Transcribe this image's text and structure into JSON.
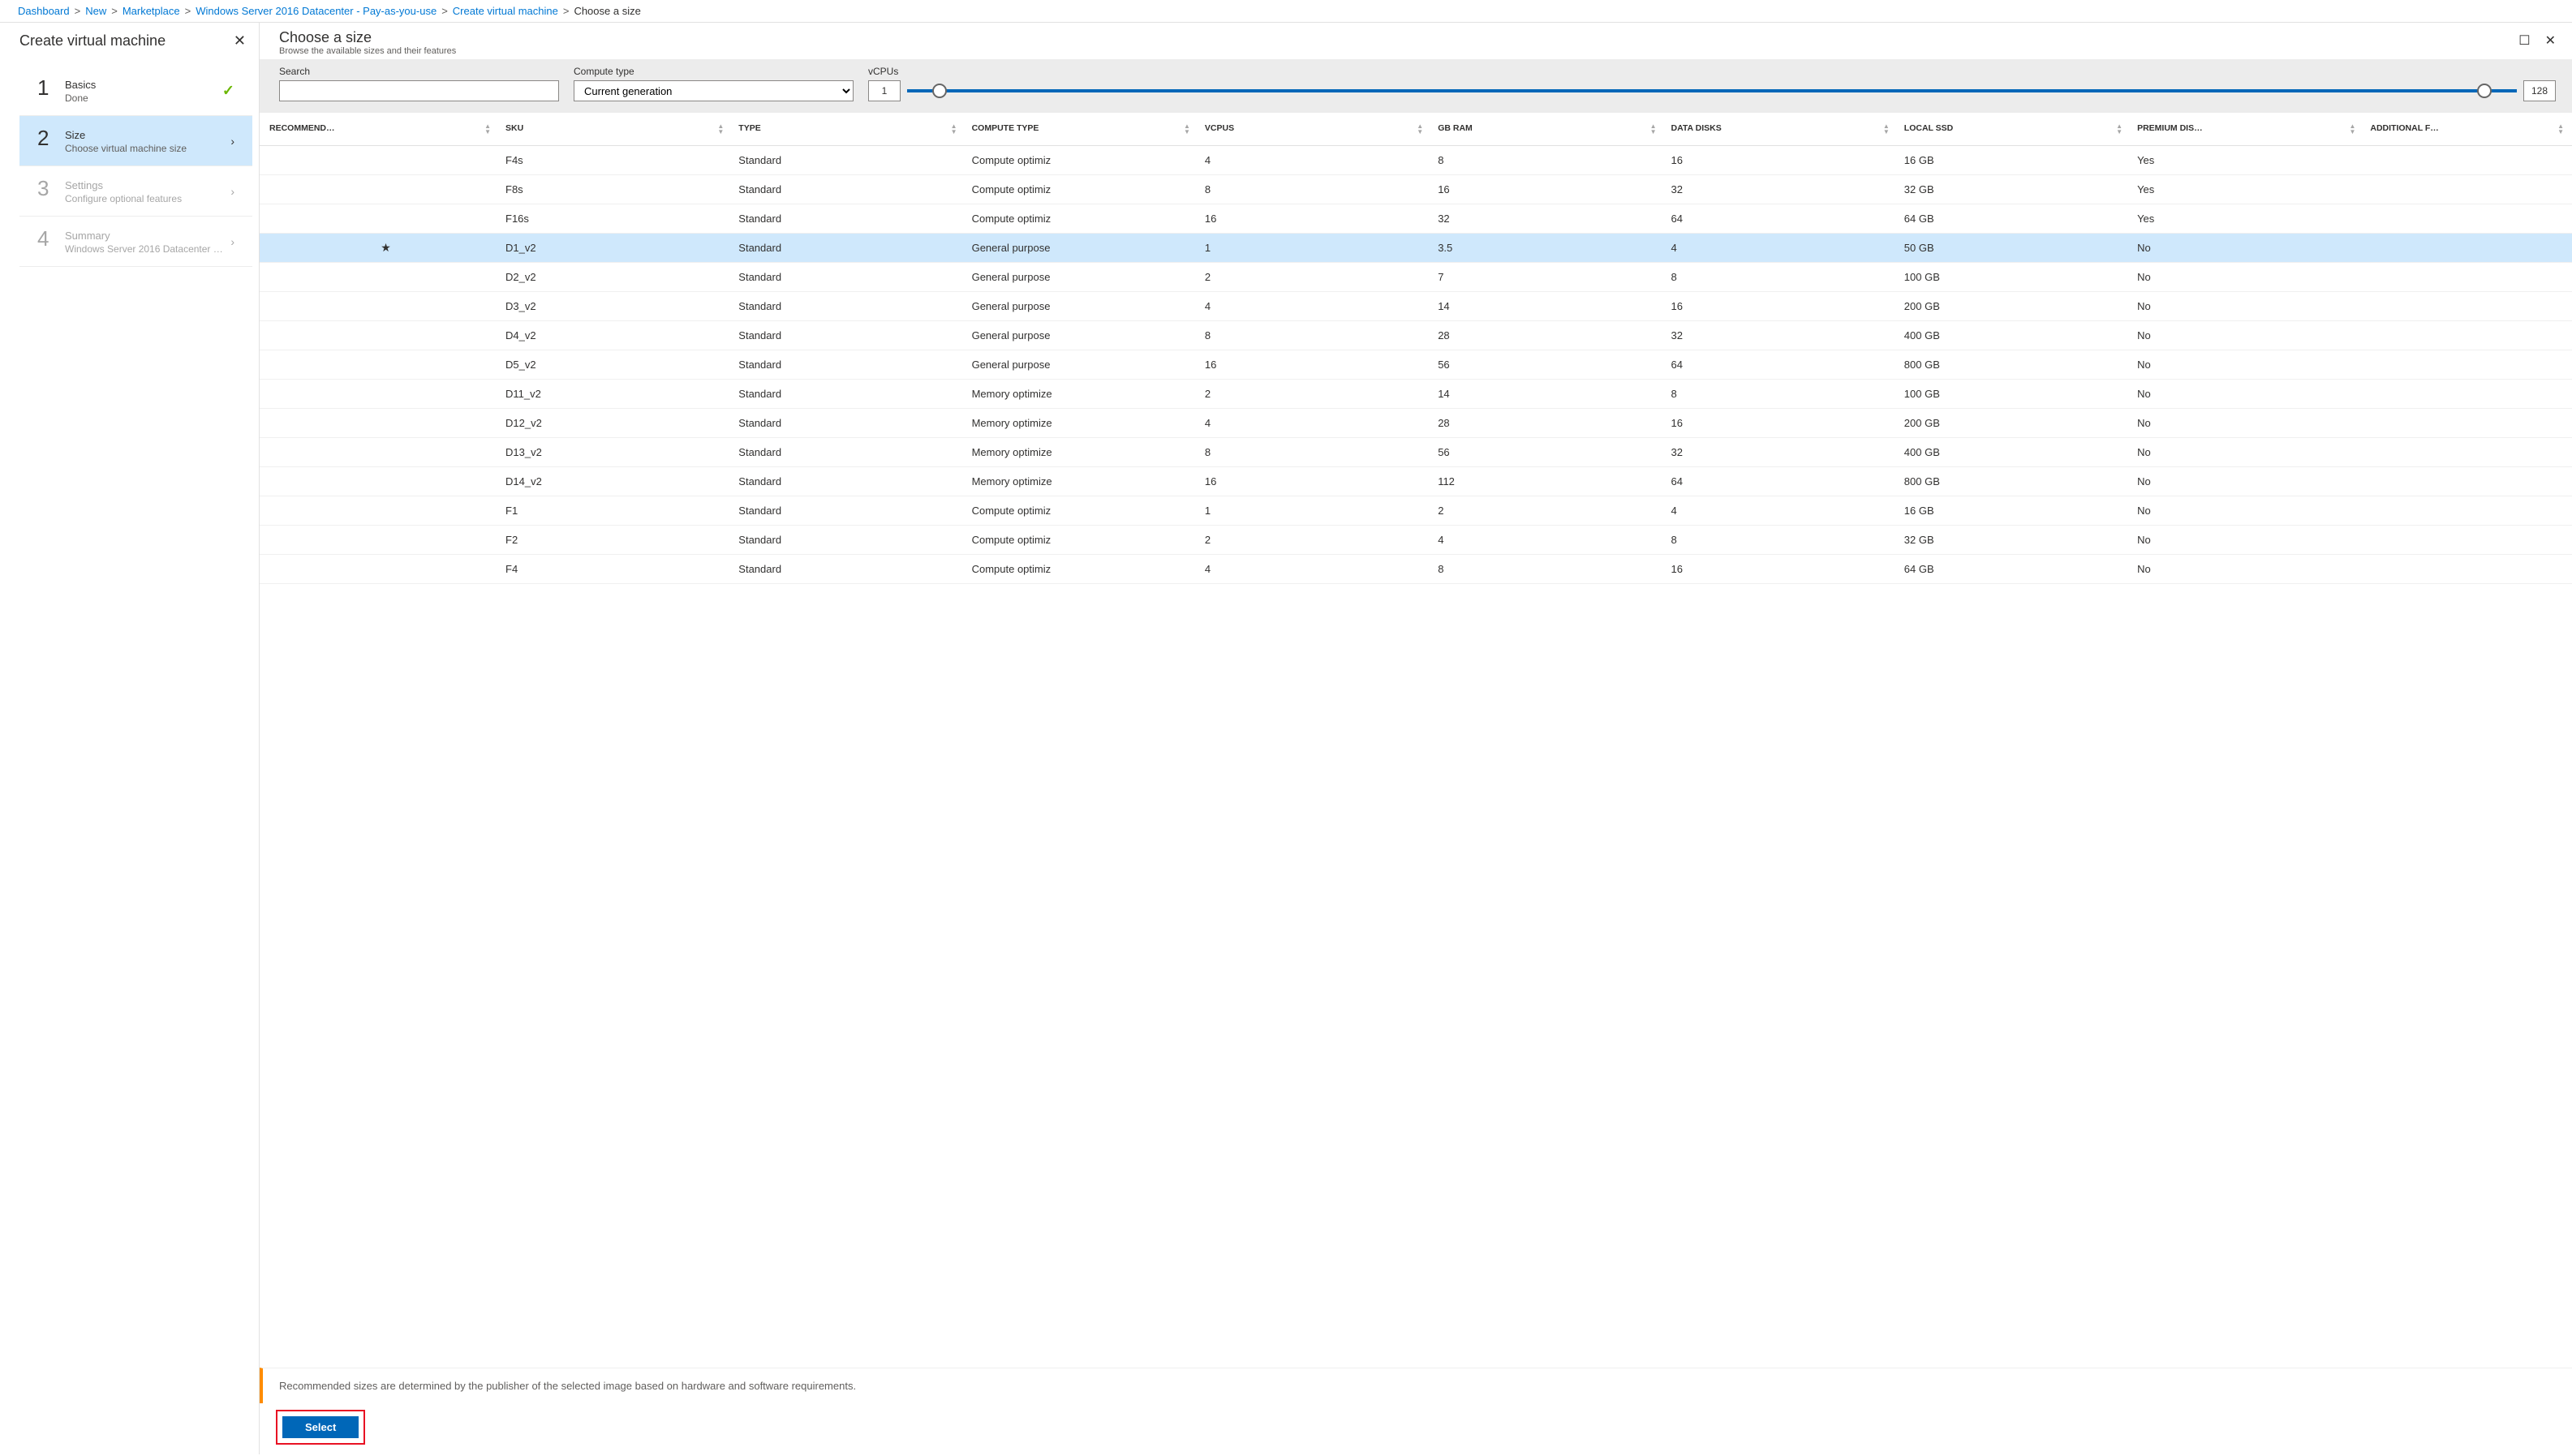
{
  "breadcrumb": {
    "items": [
      {
        "label": "Dashboard",
        "link": true
      },
      {
        "label": "New",
        "link": true
      },
      {
        "label": "Marketplace",
        "link": true
      },
      {
        "label": "Windows Server 2016 Datacenter - Pay-as-you-use",
        "link": true
      },
      {
        "label": "Create virtual machine",
        "link": true
      },
      {
        "label": "Choose a size",
        "link": false
      }
    ]
  },
  "leftPanel": {
    "title": "Create virtual machine",
    "steps": [
      {
        "num": "1",
        "title": "Basics",
        "sub": "Done",
        "state": "done"
      },
      {
        "num": "2",
        "title": "Size",
        "sub": "Choose virtual machine size",
        "state": "selected"
      },
      {
        "num": "3",
        "title": "Settings",
        "sub": "Configure optional features",
        "state": "disabled"
      },
      {
        "num": "4",
        "title": "Summary",
        "sub": "Windows Server 2016 Datacenter …",
        "state": "disabled"
      }
    ]
  },
  "rightPanel": {
    "title": "Choose a size",
    "subtitle": "Browse the available sizes and their features"
  },
  "filters": {
    "search": {
      "label": "Search",
      "value": ""
    },
    "computeType": {
      "label": "Compute type",
      "value": "Current generation"
    },
    "vcpus": {
      "label": "vCPUs",
      "min": "1",
      "max": "128"
    }
  },
  "table": {
    "columns": [
      "RECOMMEND…",
      "SKU",
      "TYPE",
      "COMPUTE TYPE",
      "VCPUS",
      "GB RAM",
      "DATA DISKS",
      "LOCAL SSD",
      "PREMIUM DIS…",
      "ADDITIONAL F…"
    ],
    "rows": [
      {
        "rec": "",
        "sku": "F4s",
        "type": "Standard",
        "compute": "Compute optimiz",
        "vcpus": "4",
        "ram": "8",
        "disks": "16",
        "ssd": "16 GB",
        "premium": "Yes",
        "add": "",
        "selected": false
      },
      {
        "rec": "",
        "sku": "F8s",
        "type": "Standard",
        "compute": "Compute optimiz",
        "vcpus": "8",
        "ram": "16",
        "disks": "32",
        "ssd": "32 GB",
        "premium": "Yes",
        "add": "",
        "selected": false
      },
      {
        "rec": "",
        "sku": "F16s",
        "type": "Standard",
        "compute": "Compute optimiz",
        "vcpus": "16",
        "ram": "32",
        "disks": "64",
        "ssd": "64 GB",
        "premium": "Yes",
        "add": "",
        "selected": false
      },
      {
        "rec": "★",
        "sku": "D1_v2",
        "type": "Standard",
        "compute": "General purpose",
        "vcpus": "1",
        "ram": "3.5",
        "disks": "4",
        "ssd": "50 GB",
        "premium": "No",
        "add": "",
        "selected": true
      },
      {
        "rec": "",
        "sku": "D2_v2",
        "type": "Standard",
        "compute": "General purpose",
        "vcpus": "2",
        "ram": "7",
        "disks": "8",
        "ssd": "100 GB",
        "premium": "No",
        "add": "",
        "selected": false
      },
      {
        "rec": "",
        "sku": "D3_v2",
        "type": "Standard",
        "compute": "General purpose",
        "vcpus": "4",
        "ram": "14",
        "disks": "16",
        "ssd": "200 GB",
        "premium": "No",
        "add": "",
        "selected": false
      },
      {
        "rec": "",
        "sku": "D4_v2",
        "type": "Standard",
        "compute": "General purpose",
        "vcpus": "8",
        "ram": "28",
        "disks": "32",
        "ssd": "400 GB",
        "premium": "No",
        "add": "",
        "selected": false
      },
      {
        "rec": "",
        "sku": "D5_v2",
        "type": "Standard",
        "compute": "General purpose",
        "vcpus": "16",
        "ram": "56",
        "disks": "64",
        "ssd": "800 GB",
        "premium": "No",
        "add": "",
        "selected": false
      },
      {
        "rec": "",
        "sku": "D11_v2",
        "type": "Standard",
        "compute": "Memory optimize",
        "vcpus": "2",
        "ram": "14",
        "disks": "8",
        "ssd": "100 GB",
        "premium": "No",
        "add": "",
        "selected": false
      },
      {
        "rec": "",
        "sku": "D12_v2",
        "type": "Standard",
        "compute": "Memory optimize",
        "vcpus": "4",
        "ram": "28",
        "disks": "16",
        "ssd": "200 GB",
        "premium": "No",
        "add": "",
        "selected": false
      },
      {
        "rec": "",
        "sku": "D13_v2",
        "type": "Standard",
        "compute": "Memory optimize",
        "vcpus": "8",
        "ram": "56",
        "disks": "32",
        "ssd": "400 GB",
        "premium": "No",
        "add": "",
        "selected": false
      },
      {
        "rec": "",
        "sku": "D14_v2",
        "type": "Standard",
        "compute": "Memory optimize",
        "vcpus": "16",
        "ram": "112",
        "disks": "64",
        "ssd": "800 GB",
        "premium": "No",
        "add": "",
        "selected": false
      },
      {
        "rec": "",
        "sku": "F1",
        "type": "Standard",
        "compute": "Compute optimiz",
        "vcpus": "1",
        "ram": "2",
        "disks": "4",
        "ssd": "16 GB",
        "premium": "No",
        "add": "",
        "selected": false
      },
      {
        "rec": "",
        "sku": "F2",
        "type": "Standard",
        "compute": "Compute optimiz",
        "vcpus": "2",
        "ram": "4",
        "disks": "8",
        "ssd": "32 GB",
        "premium": "No",
        "add": "",
        "selected": false
      },
      {
        "rec": "",
        "sku": "F4",
        "type": "Standard",
        "compute": "Compute optimiz",
        "vcpus": "4",
        "ram": "8",
        "disks": "16",
        "ssd": "64 GB",
        "premium": "No",
        "add": "",
        "selected": false
      }
    ]
  },
  "infoBar": "Recommended sizes are determined by the publisher of the selected image based on hardware and software requirements.",
  "footer": {
    "selectLabel": "Select"
  }
}
